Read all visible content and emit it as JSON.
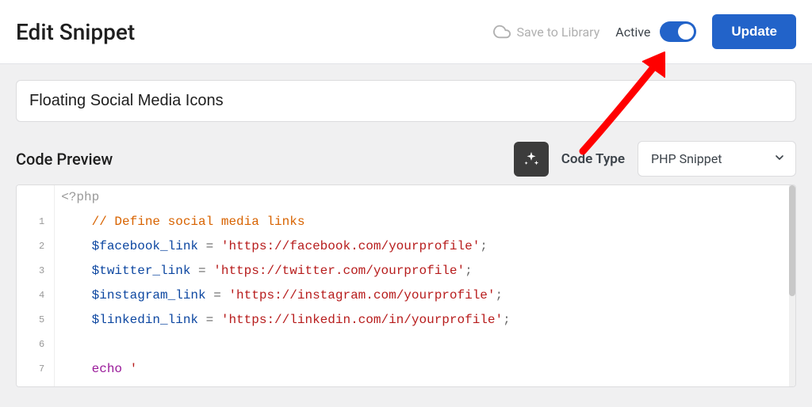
{
  "header": {
    "title": "Edit Snippet",
    "save_to_library": "Save to Library",
    "active_label": "Active",
    "update_label": "Update"
  },
  "snippet": {
    "title": "Floating Social Media Icons"
  },
  "preview": {
    "title": "Code Preview",
    "codetype_label": "Code Type",
    "codetype_value": "PHP Snippet"
  },
  "code": {
    "open": "<?php",
    "line1_comment": "// Define social media links",
    "line2_var": "$facebook_link",
    "line2_eq": " = ",
    "line2_str": "'https://facebook.com/yourprofile'",
    "line3_var": "$twitter_link",
    "line3_eq": " = ",
    "line3_str": "'https://twitter.com/yourprofile'",
    "line4_var": "$instagram_link",
    "line4_eq": " = ",
    "line4_str": "'https://instagram.com/yourprofile'",
    "line5_var": "$linkedin_link",
    "line5_eq": " = ",
    "line5_str": "'https://linkedin.com/in/yourprofile'",
    "semi": ";",
    "line7_echo": "echo",
    "line7_q": " '"
  },
  "gutter": [
    "1",
    "2",
    "3",
    "4",
    "5",
    "6",
    "7"
  ]
}
